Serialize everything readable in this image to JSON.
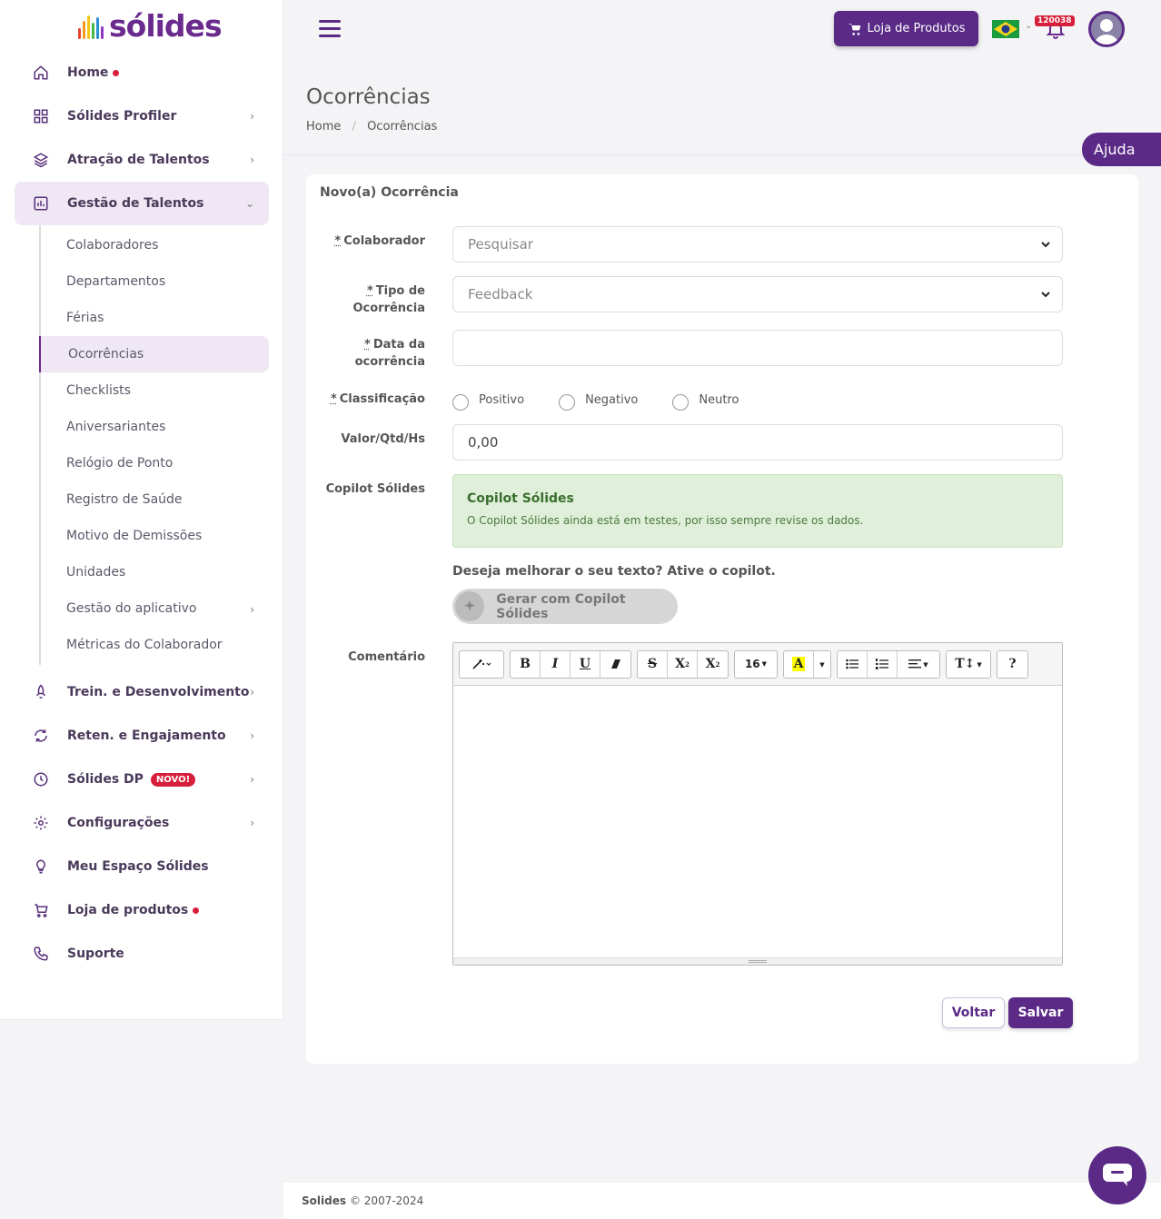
{
  "brand": {
    "name": "sólides"
  },
  "sidebar": {
    "items": [
      {
        "label": "Home"
      },
      {
        "label": "Sólides Profiler"
      },
      {
        "label": "Atração de Talentos"
      },
      {
        "label": "Gestão de Talentos"
      },
      {
        "label": "Trein. e Desenvolvimento"
      },
      {
        "label": "Reten. e Engajamento"
      },
      {
        "label": "Sólides DP",
        "badge": "NOVO!"
      },
      {
        "label": "Configurações"
      },
      {
        "label": "Meu Espaço Sólides"
      },
      {
        "label": "Loja de produtos"
      },
      {
        "label": "Suporte"
      }
    ],
    "subitems": [
      {
        "label": "Colaboradores"
      },
      {
        "label": "Departamentos"
      },
      {
        "label": "Férias"
      },
      {
        "label": "Ocorrências"
      },
      {
        "label": "Checklists"
      },
      {
        "label": "Aniversariantes"
      },
      {
        "label": "Relógio de Ponto"
      },
      {
        "label": "Registro de Saúde"
      },
      {
        "label": "Motivo de Demissões"
      },
      {
        "label": "Unidades"
      },
      {
        "label": "Gestão do aplicativo"
      },
      {
        "label": "Métricas do Colaborador"
      }
    ]
  },
  "topbar": {
    "shop_label": "Loja de Produtos",
    "notification_count": "120038"
  },
  "page": {
    "title": "Ocorrências",
    "breadcrumb": [
      "Home",
      "Ocorrências"
    ],
    "help": "Ajuda"
  },
  "form": {
    "title": "Novo(a) Ocorrência",
    "required_mark": "*",
    "labels": {
      "colaborador": "Colaborador",
      "tipo_line1": "Tipo de",
      "tipo_line2": "Ocorrência",
      "data_line1": "Data da",
      "data_line2": "ocorrência",
      "classificacao": "Classificação",
      "valor": "Valor/Qtd/Hs",
      "copilot": "Copilot Sólides",
      "comentario": "Comentário"
    },
    "colaborador_placeholder": "Pesquisar",
    "tipo_value": "Feedback",
    "data_value": "",
    "radio_options": [
      "Positivo",
      "Negativo",
      "Neutro"
    ],
    "valor_value": "0,00",
    "copilot_box": {
      "title": "Copilot Sólides",
      "desc": "O Copilot Sólides ainda está em testes, por isso sempre revise os dados."
    },
    "improve_prompt": "Deseja melhorar o seu texto? Ative o copilot.",
    "generate_button": "Gerar com Copilot Sólides",
    "editor": {
      "font_size": "16",
      "bold": "B",
      "italic": "I",
      "underline": "U",
      "strike": "S",
      "superscript": "X",
      "subscript": "X",
      "highlight": "A",
      "help": "?"
    },
    "buttons": {
      "back": "Voltar",
      "save": "Salvar"
    }
  },
  "footer": {
    "brand": "Solides",
    "copyright": "© 2007-2024"
  },
  "colors": {
    "primary": "#5a2a86",
    "danger": "#d71f3b",
    "success_bg": "#dfefd9"
  }
}
